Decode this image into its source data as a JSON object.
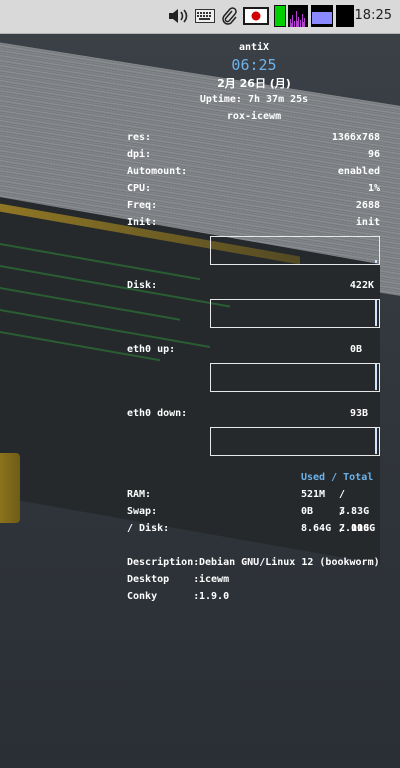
{
  "taskbar": {
    "clock": "18:25",
    "icons": [
      "volume-icon",
      "keyboard-icon",
      "paperclip-icon",
      "japan-flag-icon",
      "cpu-monitor-icon",
      "network-monitor-icon",
      "memory-monitor-icon",
      "workspace-icon"
    ]
  },
  "conky": {
    "distro": "antiX",
    "time": "06:25",
    "date": "2月 26日 (月)",
    "uptime": "Uptime: 7h 37m 25s",
    "session": "rox-icewm",
    "system": [
      {
        "label": "res:",
        "value": "1366x768"
      },
      {
        "label": "dpi:",
        "value": "96"
      },
      {
        "label": "Automount:",
        "value": "enabled"
      },
      {
        "label": "CPU:",
        "value": "1%"
      },
      {
        "label": "Freq:",
        "value": "2688"
      },
      {
        "label": "Init:",
        "value": "init"
      }
    ],
    "disk": {
      "label": "Disk:",
      "value": "422K"
    },
    "eth_up": {
      "label": "eth0 up:",
      "value": "0B"
    },
    "eth_down": {
      "label": "eth0 down:",
      "value": "93B"
    },
    "usage_header": "Used / Total",
    "usage": [
      {
        "label": "RAM:",
        "used": "521M",
        "total": "/ 3.83G"
      },
      {
        "label": "Swap:",
        "used": "0B",
        "total": "/ 2.00G"
      },
      {
        "label": "/ Disk:",
        "used": "8.64G",
        "total": "/ 118G"
      }
    ],
    "info": [
      {
        "label": "Description:",
        "value": "Debian GNU/Linux 12 (bookworm)"
      },
      {
        "label": "Desktop    :",
        "value": "icewm"
      },
      {
        "label": "Conky      :",
        "value": "1.9.0"
      }
    ]
  },
  "colors": {
    "accent": "#6db3ea",
    "taskbar": "#d9d9d9"
  }
}
